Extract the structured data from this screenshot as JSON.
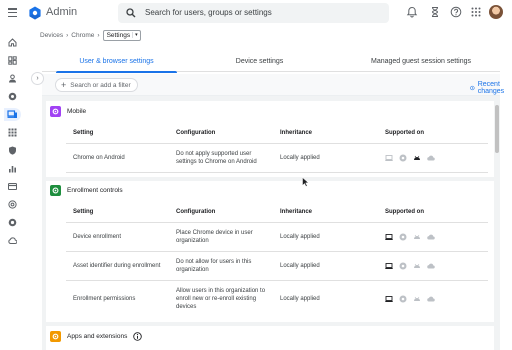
{
  "app": {
    "title": "Admin"
  },
  "search": {
    "placeholder": "Search for users, groups or settings"
  },
  "breadcrumb": {
    "items": [
      "Devices",
      "Chrome"
    ],
    "current": "Settings"
  },
  "tabs": [
    {
      "label": "User & browser settings",
      "active": true
    },
    {
      "label": "Device settings",
      "active": false
    },
    {
      "label": "Managed guest session settings",
      "active": false
    }
  ],
  "filter": {
    "placeholder": "Search or add a filter",
    "recent_label": "Recent changes"
  },
  "columns": {
    "setting": "Setting",
    "configuration": "Configuration",
    "inheritance": "Inheritance",
    "supported": "Supported on"
  },
  "sections": [
    {
      "title": "Mobile",
      "icon": "gear-icon",
      "color": "#a142f4",
      "rows": [
        {
          "setting": "Chrome on Android",
          "configuration": "Do not apply supported user settings to Chrome on Android",
          "inheritance": "Locally applied",
          "platforms": [
            "laptop",
            "chrome",
            "android",
            "cloud"
          ]
        }
      ]
    },
    {
      "title": "Enrollment controls",
      "icon": "enrollment-icon",
      "color": "#1e8e3e",
      "rows": [
        {
          "setting": "Device enrollment",
          "configuration": "Place Chrome device in user organization",
          "inheritance": "Locally applied",
          "platforms": [
            "laptop",
            "chrome",
            "android",
            "cloud"
          ]
        },
        {
          "setting": "Asset identifier during enrollment",
          "configuration": "Do not allow for users in this organization",
          "inheritance": "Locally applied",
          "platforms": [
            "laptop",
            "chrome",
            "android",
            "cloud"
          ]
        },
        {
          "setting": "Enrollment permissions",
          "configuration": "Allow users in this organization to enroll new or re-enroll existing devices",
          "inheritance": "Locally applied",
          "platforms": [
            "laptop",
            "chrome",
            "android",
            "cloud"
          ]
        }
      ]
    },
    {
      "title": "Apps and extensions",
      "icon": "apps-icon",
      "color": "#f29900"
    }
  ],
  "colors": {
    "accent": "#1a73e8",
    "platform_active": "#202124",
    "platform_inactive": "#bdc1c6"
  }
}
